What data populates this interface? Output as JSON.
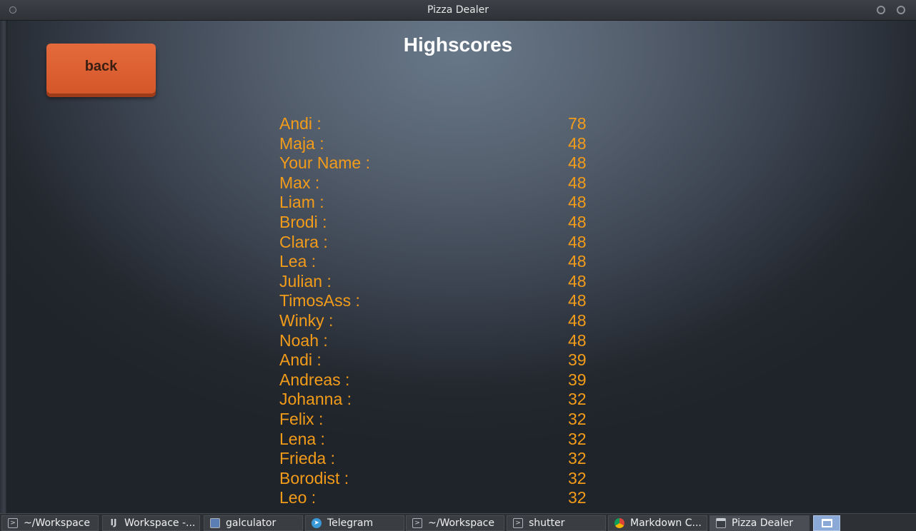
{
  "window": {
    "title": "Pizza Dealer"
  },
  "screen": {
    "heading": "Highscores",
    "back_label": "back"
  },
  "scores": [
    {
      "name": "Andi :",
      "score": "78"
    },
    {
      "name": "Maja :",
      "score": "48"
    },
    {
      "name": "Your Name :",
      "score": "48"
    },
    {
      "name": "Max :",
      "score": "48"
    },
    {
      "name": "Liam :",
      "score": "48"
    },
    {
      "name": "Brodi :",
      "score": "48"
    },
    {
      "name": "Clara :",
      "score": "48"
    },
    {
      "name": "Lea :",
      "score": "48"
    },
    {
      "name": "Julian :",
      "score": "48"
    },
    {
      "name": "TimosAss :",
      "score": "48"
    },
    {
      "name": "Winky :",
      "score": "48"
    },
    {
      "name": "Noah :",
      "score": "48"
    },
    {
      "name": "Andi :",
      "score": "39"
    },
    {
      "name": "Andreas :",
      "score": "39"
    },
    {
      "name": "Johanna :",
      "score": "32"
    },
    {
      "name": "Felix :",
      "score": "32"
    },
    {
      "name": "Lena :",
      "score": "32"
    },
    {
      "name": "Frieda :",
      "score": "32"
    },
    {
      "name": "Borodist :",
      "score": "32"
    },
    {
      "name": "Leo :",
      "score": "32"
    }
  ],
  "taskbar": {
    "items": [
      {
        "label": "~/Workspace",
        "icon": "terminal-icon"
      },
      {
        "label": "Workspace -...",
        "icon": "intellij-icon"
      },
      {
        "label": "galculator",
        "icon": "calculator-icon"
      },
      {
        "label": "Telegram",
        "icon": "telegram-icon"
      },
      {
        "label": "~/Workspace",
        "icon": "terminal-icon"
      },
      {
        "label": "shutter",
        "icon": "terminal-icon"
      },
      {
        "label": "Markdown C...",
        "icon": "chrome-icon"
      },
      {
        "label": "Pizza Dealer",
        "icon": "window-icon"
      }
    ]
  },
  "colors": {
    "score_text": "#f39c1a",
    "button": "#d95f30",
    "heading": "#ffffff"
  }
}
